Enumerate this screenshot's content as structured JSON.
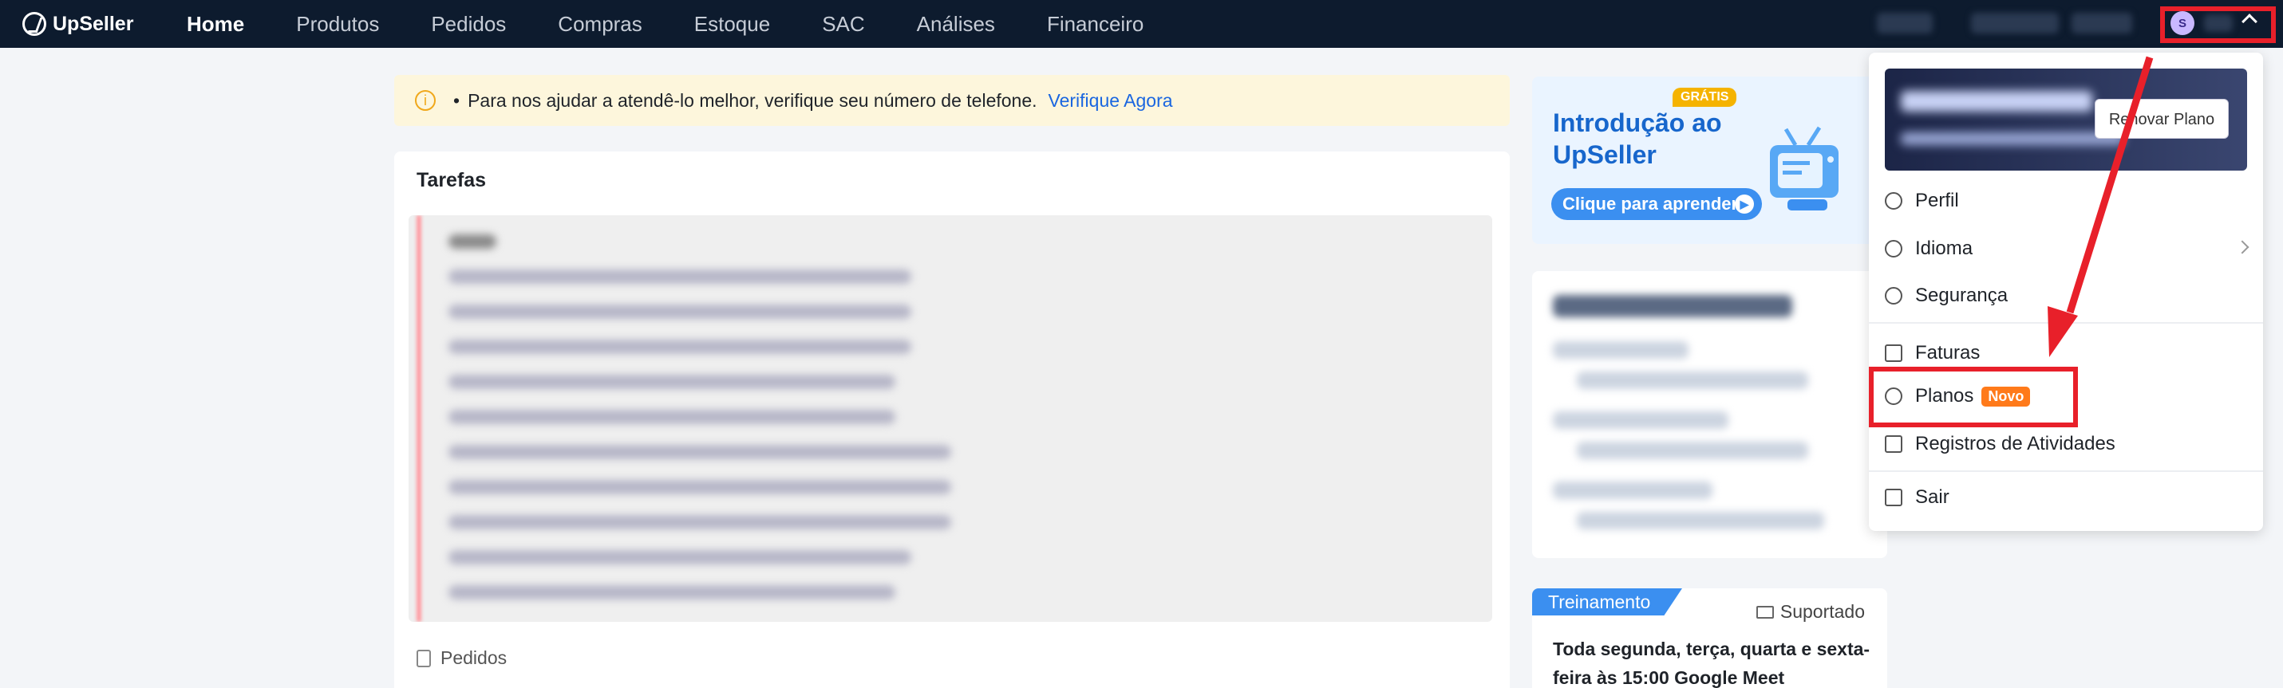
{
  "app": {
    "logo_text": "UpSeller"
  },
  "nav": {
    "items": [
      "Home",
      "Produtos",
      "Pedidos",
      "Compras",
      "Estoque",
      "SAC",
      "Análises",
      "Financeiro"
    ],
    "active_index": 0
  },
  "header": {
    "plan_icon_letter": "S"
  },
  "notice": {
    "text": "Para nos ajudar a atendê-lo melhor, verifique seu número de telefone.",
    "link": "Verifique Agora"
  },
  "tasks": {
    "title": "Tarefas",
    "footer_label": "Pedidos"
  },
  "intro_card": {
    "badge": "GRÁTIS",
    "title": "Introdução ao UpSeller",
    "cta": "Clique para aprender"
  },
  "training": {
    "tag": "Treinamento",
    "support": "Suportado",
    "text": "Toda segunda, terça, quarta e sexta-feira às 15:00 Google Meet"
  },
  "dropdown": {
    "renew_button": "Renovar Plano",
    "items": [
      {
        "label": "Perfil",
        "icon": "user-icon"
      },
      {
        "label": "Idioma",
        "icon": "language-icon"
      },
      {
        "label": "Segurança",
        "icon": "shield-icon"
      },
      {
        "label": "Faturas",
        "icon": "invoice-icon"
      },
      {
        "label": "Planos",
        "icon": "diamond-icon",
        "badge": "Novo"
      },
      {
        "label": "Registros de Atividades",
        "icon": "activity-log-icon"
      },
      {
        "label": "Sair",
        "icon": "logout-icon"
      }
    ]
  },
  "colors": {
    "nav_bg": "#0d1b2e",
    "accent": "#1a66e0",
    "highlight": "#e8202a",
    "badge_orange": "#ff7a1a"
  }
}
